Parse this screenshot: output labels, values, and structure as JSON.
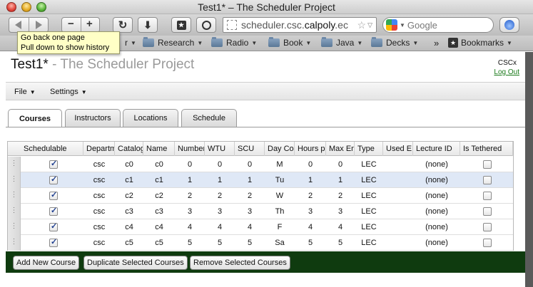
{
  "window": {
    "title": "Test1* – The Scheduler Project"
  },
  "toolbar": {
    "back_icon": "left-triangle",
    "forward_icon": "right-triangle",
    "zoom_out_label": "−",
    "zoom_in_label": "+",
    "url_host": "scheduler.csc.",
    "url_domain": "calpoly",
    "url_tail": ".ec",
    "search_placeholder": "Google"
  },
  "tooltip": {
    "line1": "Go back one page",
    "line2": "Pull down to show history"
  },
  "bookmarks": [
    {
      "label": "r"
    },
    {
      "label": "Research"
    },
    {
      "label": "Radio"
    },
    {
      "label": "Book"
    },
    {
      "label": "Java"
    },
    {
      "label": "Decks"
    },
    {
      "label": "Bookmarks"
    }
  ],
  "app": {
    "title": "Test1*",
    "subtitle": " - The Scheduler Project",
    "user": "CSCx",
    "logout": "Log Out"
  },
  "menus": [
    "File",
    "Settings"
  ],
  "tabs": [
    "Courses",
    "Instructors",
    "Locations",
    "Schedule"
  ],
  "active_tab": "Courses",
  "grid": {
    "columns": [
      "Schedulable",
      "Departm",
      "Catalog",
      "Name",
      "Number",
      "WTU",
      "SCU",
      "Day Co",
      "Hours p",
      "Max En",
      "Type",
      "Used E",
      "Lecture ID",
      "Is Tethered"
    ],
    "rows": [
      {
        "schedulable": true,
        "dept": "csc",
        "catalog": "c0",
        "name": "c0",
        "number": "0",
        "wtu": "0",
        "scu": "0",
        "days": "M",
        "hours": "0",
        "max": "0",
        "type": "LEC",
        "used": "",
        "lecture": "(none)",
        "tethered": false,
        "selected": false
      },
      {
        "schedulable": true,
        "dept": "csc",
        "catalog": "c1",
        "name": "c1",
        "number": "1",
        "wtu": "1",
        "scu": "1",
        "days": "Tu",
        "hours": "1",
        "max": "1",
        "type": "LEC",
        "used": "",
        "lecture": "(none)",
        "tethered": false,
        "selected": true
      },
      {
        "schedulable": true,
        "dept": "csc",
        "catalog": "c2",
        "name": "c2",
        "number": "2",
        "wtu": "2",
        "scu": "2",
        "days": "W",
        "hours": "2",
        "max": "2",
        "type": "LEC",
        "used": "",
        "lecture": "(none)",
        "tethered": false,
        "selected": false
      },
      {
        "schedulable": true,
        "dept": "csc",
        "catalog": "c3",
        "name": "c3",
        "number": "3",
        "wtu": "3",
        "scu": "3",
        "days": "Th",
        "hours": "3",
        "max": "3",
        "type": "LEC",
        "used": "",
        "lecture": "(none)",
        "tethered": false,
        "selected": false
      },
      {
        "schedulable": true,
        "dept": "csc",
        "catalog": "c4",
        "name": "c4",
        "number": "4",
        "wtu": "4",
        "scu": "4",
        "days": "F",
        "hours": "4",
        "max": "4",
        "type": "LEC",
        "used": "",
        "lecture": "(none)",
        "tethered": false,
        "selected": false
      },
      {
        "schedulable": true,
        "dept": "csc",
        "catalog": "c5",
        "name": "c5",
        "number": "5",
        "wtu": "5",
        "scu": "5",
        "days": "Sa",
        "hours": "5",
        "max": "5",
        "type": "LEC",
        "used": "",
        "lecture": "(none)",
        "tethered": false,
        "selected": false
      }
    ]
  },
  "actions": [
    "Add New Course",
    "Duplicate Selected Courses",
    "Remove Selected Courses"
  ],
  "colors": {
    "action_bar": "#0f3b0f",
    "selected_row": "#dfe8f6",
    "logout_link": "#1a7a1a"
  }
}
